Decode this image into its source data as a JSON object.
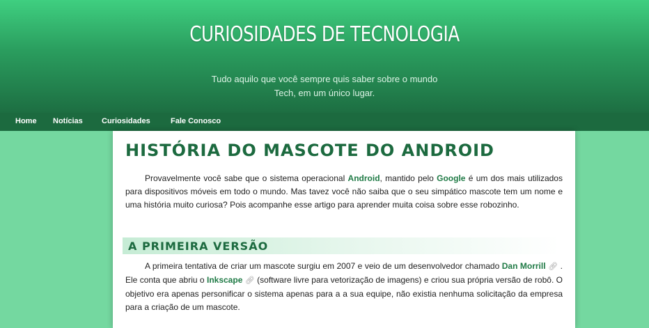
{
  "header": {
    "site_title": "CURIOSIDADES DE TECNOLOGIA",
    "subtitle_line1": "Tudo aquilo que você sempre quis saber sobre o mundo",
    "subtitle_line2": "Tech, em um único lugar."
  },
  "nav": {
    "items": [
      {
        "label": "Home"
      },
      {
        "label": "Notícias"
      },
      {
        "label": "Curiosidades"
      },
      {
        "label": "Fale Conosco"
      }
    ]
  },
  "article": {
    "title": "História do mascote do Android",
    "intro": {
      "t1": "Provavelmente você sabe que o sistema operacional ",
      "link_android": "Android",
      "t2": ", mantido pelo ",
      "link_google": "Google",
      "t3": " é um dos mais utilizados para dispositivos móveis em todo o mundo. Mas tavez você não saiba que o seu simpático mascote tem um nome e uma história muito curiosa? Pois acompanhe esse artigo para aprender muita coisa sobre esse robozinho."
    },
    "section1": {
      "heading": "A primeira versão",
      "t1": "A primeira tentativa de criar um mascote surgiu em 2007 e veio de um desenvolvedor chamado ",
      "link_dan": "Dan Morrill",
      "t2": " . Ele conta que abriu o ",
      "link_inkscape": "Inkscape",
      "t3": "  (software livre para vetorização de imagens) e criou sua própria versão de robô. O objetivo era apenas personificar o sistema apenas para a a sua equipe, não existia nenhuma solicitação da empresa para a criação de um mascote."
    }
  },
  "icons": {
    "external_link": "external-link-icon"
  },
  "colors": {
    "background": "#74d8a0",
    "header_top": "#3fcf80",
    "header_bottom": "#1d6e42",
    "nav_bar": "#1c6a3f",
    "accent_text": "#1c6a3f",
    "link": "#1f7a45"
  }
}
